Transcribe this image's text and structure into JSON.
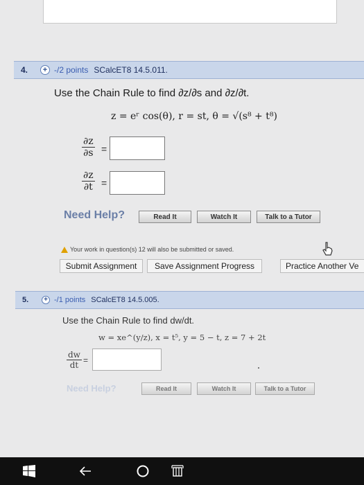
{
  "q4": {
    "number": "4.",
    "points": "-/2 points",
    "code": "SCalcET8 14.5.011.",
    "prompt": "Use the Chain Rule to find ∂z/∂s and ∂z/∂t.",
    "equation": "z = eʳ cos(θ),   r = st,   θ = √(s⁸ + t⁸)",
    "derivatives": [
      {
        "num": "∂z",
        "den": "∂s",
        "eq": "=",
        "value": ""
      },
      {
        "num": "∂z",
        "den": "∂t",
        "eq": "=",
        "value": ""
      }
    ],
    "need_help": "Need Help?",
    "buttons": {
      "read": "Read It",
      "watch": "Watch It",
      "tutor": "Talk to a Tutor"
    }
  },
  "notice": "Your work in question(s) 12 will also be submitted or saved.",
  "actions": {
    "submit": "Submit Assignment",
    "save": "Save Assignment Progress",
    "practice": "Practice Another Ve"
  },
  "q5": {
    "number": "5.",
    "points": "-/1 points",
    "code": "SCalcET8 14.5.005.",
    "prompt": "Use the Chain Rule to find dw/dt.",
    "equation": "w = xe^(y/z),   x = t⁵,   y = 5 − t,   z = 7 + 2t",
    "derivative": {
      "num": "dw",
      "den": "dt",
      "eq": "=",
      "value": ""
    },
    "need_help": "Need Help?",
    "buttons": {
      "read": "Read It",
      "watch": "Watch It",
      "tutor": "Talk to a Tutor"
    }
  },
  "colors": {
    "header_bg": "#c9d6ea",
    "taskbar": "#101010",
    "points_negative": "#c12b2b"
  }
}
